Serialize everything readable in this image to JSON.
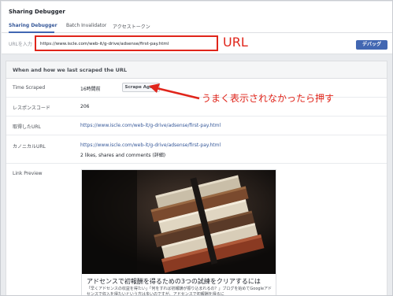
{
  "app": {
    "title": "Sharing Debugger"
  },
  "tabs": [
    {
      "label": "Sharing Debugger"
    },
    {
      "label": "Batch Invalidator"
    },
    {
      "label": "アクセストークン"
    }
  ],
  "url_bar": {
    "label": "URLを入力",
    "value": "https://www.iscle.com/web-it/g-drive/adsense/first-pay.html",
    "callout": "URL",
    "debug_label": "デバッグ"
  },
  "panel": {
    "title": "When and how we last scraped the URL",
    "rows": [
      {
        "label": "Time Scraped",
        "value": "16時間前",
        "button": "Scrape Again"
      },
      {
        "label": "レスポンスコード",
        "value": "206"
      },
      {
        "label": "取得したURL",
        "value": "https://www.iscle.com/web-it/g-drive/adsense/first-pay.html"
      },
      {
        "label": "カノニカルURL",
        "value": "https://www.iscle.com/web-it/g-drive/adsense/first-pay.html",
        "extra": "2 likes, shares and comments (詳細)"
      },
      {
        "label": "Link Preview"
      }
    ]
  },
  "annotation": {
    "text": "うまく表示されなかったら押す"
  },
  "preview": {
    "title": "アドセンスで初報酬を得るための3つの試練をクリアするには",
    "description": "「早くアドセンスの収益を得たい」「何をすれば初報酬が振り込まれるの？」ブログを始めてGoogleアドセンスで収入を得たいという方は多いのですが、アドセンスで初報酬を得るに"
  },
  "colors": {
    "accent": "#4267b2",
    "annotation_red": "#e0251b",
    "link": "#365899"
  }
}
